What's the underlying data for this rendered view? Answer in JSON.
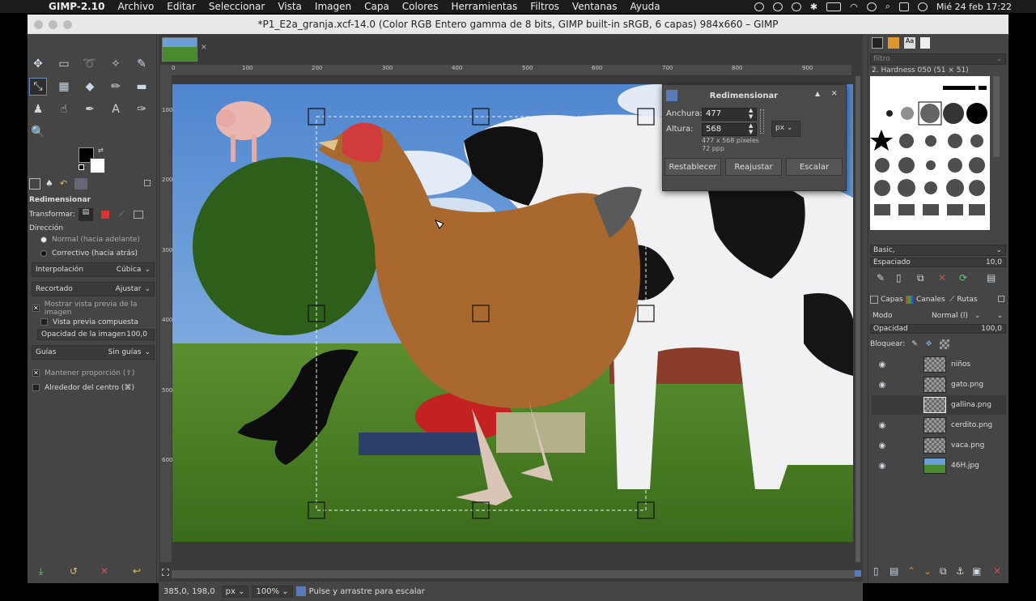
{
  "menubar": {
    "app": "GIMP-2.10",
    "items": [
      "Archivo",
      "Editar",
      "Seleccionar",
      "Vista",
      "Imagen",
      "Capa",
      "Colores",
      "Herramientas",
      "Filtros",
      "Ventanas",
      "Ayuda"
    ],
    "datetime": "Mié 24 feb  17:22"
  },
  "window": {
    "title": "*P1_E2a_granja.xcf-14.0 (Color RGB Entero gamma de 8 bits, GIMP built-in sRGB, 6 capas) 984x660 – GIMP"
  },
  "tool_options": {
    "title": "Redimensionar",
    "transform_label": "Transformar:",
    "direction_label": "Dirección",
    "dir_normal": "Normal (hacia adelante)",
    "dir_corrective": "Correctivo (hacia atrás)",
    "interp_label": "Interpolación",
    "interp_value": "Cúbica",
    "clip_label": "Recortado",
    "clip_value": "Ajustar",
    "show_preview": "Mostrar vista previa de la imagen",
    "composite_preview": "Vista previa compuesta",
    "opacity_label": "Opacidad de la imagen",
    "opacity_value": "100,0",
    "guides_label": "Guías",
    "guides_value": "Sin guías",
    "keep_aspect": "Mantener proporción (⇧)",
    "around_center": "Alrededor del centro (⌘)"
  },
  "ruler": {
    "h_ticks": [
      "0",
      "100",
      "200",
      "300",
      "400",
      "500",
      "600",
      "700",
      "800",
      "900"
    ],
    "v_ticks": [
      "100",
      "200",
      "300",
      "400",
      "500",
      "600"
    ]
  },
  "scale_dialog": {
    "title": "Redimensionar",
    "width_label": "Anchura:",
    "width_value": "477",
    "height_label": "Altura:",
    "height_value": "568",
    "unit": "px",
    "size_info": "477 x 568 píxeles",
    "ppi": "72 ppp",
    "btn_reset": "Restablecer",
    "btn_readjust": "Reajustar",
    "btn_scale": "Escalar"
  },
  "status": {
    "coords": "385,0, 198,0",
    "unit": "px",
    "zoom": "100%",
    "message": "Pulse y arrastre para escalar"
  },
  "brushes": {
    "filter_placeholder": "filtro",
    "current": "2. Hardness 050 (51 × 51)",
    "preset": "Basic,",
    "spacing_label": "Espaciado",
    "spacing_value": "10,0"
  },
  "layers": {
    "tabs": [
      "Capas",
      "Canales",
      "Rutas"
    ],
    "mode_label": "Modo",
    "mode_value": "Normal (l)",
    "opacity_label": "Opacidad",
    "opacity_value": "100,0",
    "lock_label": "Bloquear:",
    "items": [
      {
        "name": "niños",
        "visible": true
      },
      {
        "name": "gato.png",
        "visible": true
      },
      {
        "name": "gallina.png",
        "visible": false
      },
      {
        "name": "cerdito.png",
        "visible": true
      },
      {
        "name": "vaca.png",
        "visible": true
      },
      {
        "name": "46H.jpg",
        "visible": true
      }
    ]
  }
}
